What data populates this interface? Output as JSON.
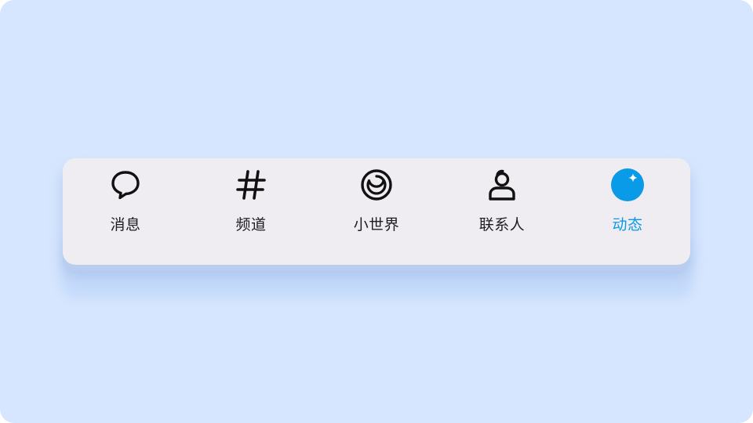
{
  "tab_bar": {
    "active_tab": "动态",
    "active_color": "#0a9be8",
    "items": [
      {
        "label": "消息",
        "icon": "chat-bubble-icon"
      },
      {
        "label": "频道",
        "icon": "hash-icon"
      },
      {
        "label": "小世界",
        "icon": "planet-icon"
      },
      {
        "label": "联系人",
        "icon": "person-icon"
      },
      {
        "label": "动态",
        "icon": "sparkle-orb-icon"
      }
    ]
  }
}
